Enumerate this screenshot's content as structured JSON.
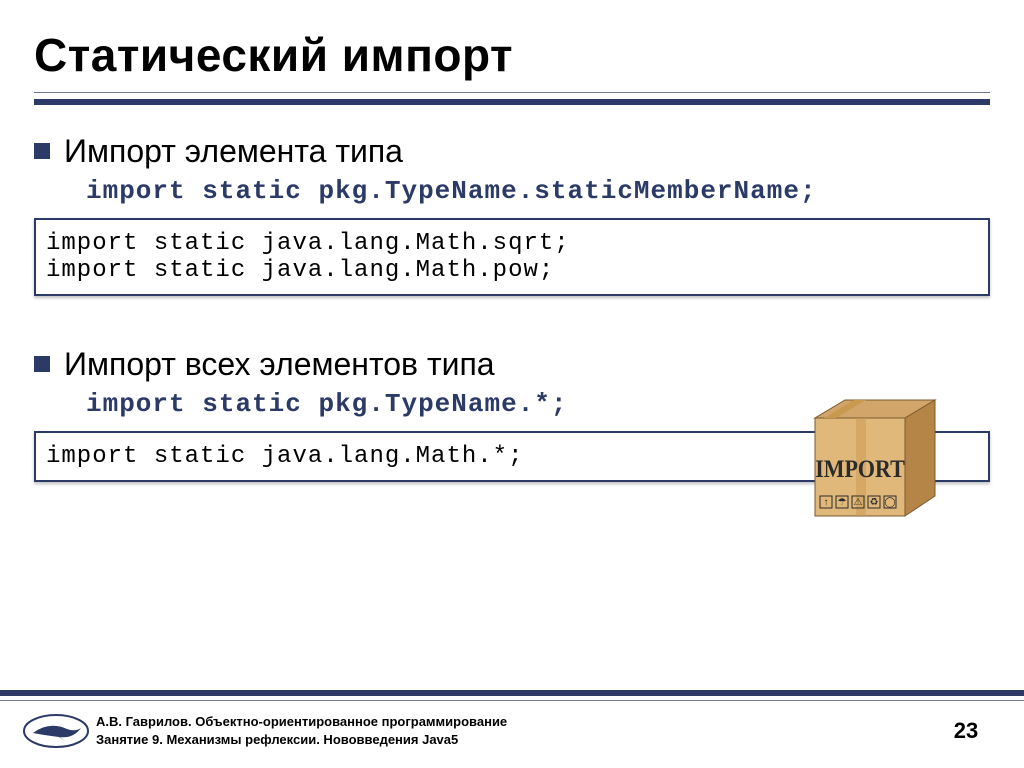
{
  "title": "Статический импорт",
  "bullet1": {
    "text": "Импорт элемента типа",
    "code_import": "import",
    "code_static": "static",
    "code_rest": "pkg.TypeName.staticMemberName;"
  },
  "codebox1": {
    "line1": "import static java.lang.Math.sqrt;",
    "line2": "import static java.lang.Math.pow;"
  },
  "bullet2": {
    "text": "Импорт всех элементов типа",
    "code_import": "import",
    "code_static": "static",
    "code_rest": "pkg.TypeName.*;"
  },
  "codebox2": {
    "line1": "import static java.lang.Math.*;"
  },
  "box_label": "IMPORT",
  "footer": {
    "line1": "А.В. Гаврилов. Объектно-ориентированное программирование",
    "line2": "Занятие 9. Механизмы рефлексии. Нововведения Java5",
    "page": "23"
  }
}
